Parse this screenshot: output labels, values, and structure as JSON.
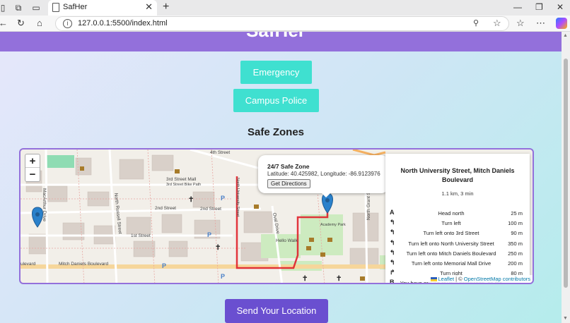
{
  "browser": {
    "tab_title": "SafHer",
    "url": "127.0.0.1:5500/index.html",
    "new_tab_symbol": "+",
    "close_symbol": "✕"
  },
  "page": {
    "app_title": "SafHer",
    "buttons": {
      "emergency": "Emergency",
      "campus_police": "Campus Police",
      "send_location": "Send Your Location"
    },
    "safe_zones_title": "Safe Zones"
  },
  "map": {
    "zoom_in": "+",
    "zoom_out": "−",
    "popup": {
      "title": "24/7 Safe Zone",
      "coords": "Latitude: 40.425982, Longitude: -86.9123976",
      "button": "Get Directions"
    },
    "streets": {
      "fourth": "4th Street",
      "third_mall": "3rd Street Mall",
      "third_bike": "3rd Street Bike Path",
      "second_w": "2nd Street",
      "second_e": "2nd Street",
      "first": "1st Street",
      "mitch": "Mitch Daniels Boulevard",
      "evard": "ulevard",
      "macarthur": "MacArthur Drive",
      "north_russell": "North Russell Street",
      "oval": "Oval Drive",
      "hello_walk": "Hello Walk",
      "academy": "Academy Park",
      "north_grant": "North Grant Street",
      "north_university": "North University Street"
    },
    "directions": {
      "header": "North University Street, Mitch Daniels Boulevard",
      "summary": "1.1 km, 3 min",
      "steps": [
        {
          "icon": "A",
          "text": "Head north",
          "dist": "25 m"
        },
        {
          "icon": "↰",
          "text": "Turn left",
          "dist": "100 m"
        },
        {
          "icon": "↰",
          "text": "Turn left onto 3rd Street",
          "dist": "90 m"
        },
        {
          "icon": "↰",
          "text": "Turn left onto North University Street",
          "dist": "350 m"
        },
        {
          "icon": "↰",
          "text": "Turn left onto Mitch Daniels Boulevard",
          "dist": "250 m"
        },
        {
          "icon": "↰",
          "text": "Turn left onto Memorial Mall Drive",
          "dist": "200 m"
        },
        {
          "icon": "↱",
          "text": "Turn right",
          "dist": "80 m"
        },
        {
          "icon": "B",
          "text": "You have arrived at your destination, on the",
          "dist": ""
        }
      ]
    },
    "attribution": {
      "leaflet": "Leaflet",
      "separator": " | © ",
      "osm": "OpenStreetMap contributors"
    }
  },
  "colors": {
    "header": "#9370db",
    "teal_button": "#3fe0d0",
    "send_button": "#6a4fd0",
    "route": "#e0202a",
    "marker": "#2a81cb"
  }
}
